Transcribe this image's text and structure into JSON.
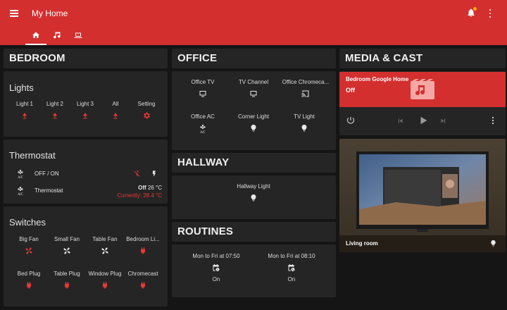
{
  "header": {
    "title": "My Home"
  },
  "colors": {
    "accent": "#d32f2f",
    "card": "#252525",
    "background": "#151515",
    "status_warm": "#e53935",
    "badge": "#ffb300"
  },
  "tabs": [
    {
      "icon": "home-icon",
      "active": true
    },
    {
      "icon": "music-icon",
      "active": false
    },
    {
      "icon": "laptop-icon",
      "active": false
    }
  ],
  "bedroom": {
    "heading": "BEDROOM",
    "lights": {
      "title": "Lights",
      "items": [
        {
          "label": "Light 1",
          "icon": "lamp-icon"
        },
        {
          "label": "Light 2",
          "icon": "lamp-icon"
        },
        {
          "label": "Light 3",
          "icon": "lamp-icon"
        },
        {
          "label": "All",
          "icon": "lamp-icon"
        },
        {
          "label": "Setting",
          "icon": "gear-icon"
        }
      ]
    },
    "thermostat": {
      "title": "Thermostat",
      "rows": [
        {
          "label": "OFF / ON",
          "icon": "air-conditioner-icon"
        },
        {
          "label": "Thermostat",
          "icon": "air-conditioner-icon"
        }
      ],
      "state": "Off",
      "target": "26 °C",
      "current": "Currently: 28.4 °C"
    },
    "switches": {
      "title": "Switches",
      "items": [
        {
          "label": "Big Fan",
          "icon": "fan-icon"
        },
        {
          "label": "Small Fan",
          "icon": "fan-icon"
        },
        {
          "label": "Table Fan",
          "icon": "fan-icon"
        },
        {
          "label": "Bedroom Li...",
          "icon": "power-plug-icon"
        },
        {
          "label": "Bed Plug",
          "icon": "power-plug-icon"
        },
        {
          "label": "Table Plug",
          "icon": "power-plug-icon"
        },
        {
          "label": "Window Plug",
          "icon": "power-plug-icon"
        },
        {
          "label": "Chromecast",
          "icon": "power-plug-icon"
        }
      ]
    }
  },
  "office": {
    "heading": "OFFICE",
    "items": [
      {
        "label": "Office TV",
        "icon": "tv-icon"
      },
      {
        "label": "TV Channel",
        "icon": "tv-icon"
      },
      {
        "label": "Office Chromeca...",
        "icon": "cast-icon"
      },
      {
        "label": "Office AC",
        "icon": "air-conditioner-icon"
      },
      {
        "label": "Corner Light",
        "icon": "bulb-icon"
      },
      {
        "label": "TV Light",
        "icon": "bulb-icon"
      }
    ]
  },
  "hallway": {
    "heading": "HALLWAY",
    "item": {
      "label": "Hallway Light",
      "icon": "bulb-icon"
    }
  },
  "routines": {
    "heading": "ROUTINES",
    "items": [
      {
        "label": "Mon to Fri at 07:50",
        "icon": "calendar-clock-icon",
        "state": "On"
      },
      {
        "label": "Mon to Fri at 08:10",
        "icon": "calendar-clock-icon",
        "state": "On"
      }
    ]
  },
  "media": {
    "heading": "MEDIA & CAST",
    "player": {
      "name": "Bedroom Google Home",
      "state": "Off"
    },
    "camera": {
      "label": "Living room"
    }
  }
}
